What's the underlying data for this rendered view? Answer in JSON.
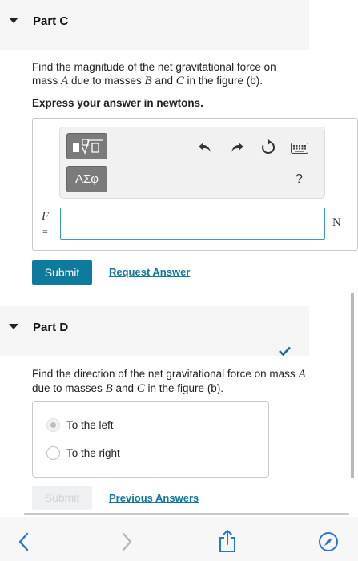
{
  "part_c": {
    "title": "Part C",
    "question_pre": "Find the magnitude of the net gravitational force on mass ",
    "mass_a": "A",
    "question_mid1": " due to masses ",
    "mass_b": "B",
    "question_mid2": " and ",
    "mass_c": "C",
    "question_post": " in the figure (b).",
    "instruction": "Express your answer in newtons.",
    "toolbar": {
      "greek_label": "ΑΣφ",
      "help_label": "?"
    },
    "input": {
      "variable": "F",
      "equals": "=",
      "value": "",
      "unit": "N"
    },
    "submit_label": "Submit",
    "request_label": "Request Answer"
  },
  "part_d": {
    "title": "Part D",
    "question_pre": "Find the direction of the net gravitational force on mass ",
    "mass_a": "A",
    "question_mid1": " due to masses ",
    "mass_b": "B",
    "question_mid2": " and ",
    "mass_c": "C",
    "question_post": " in the figure (b).",
    "options": [
      "To the left",
      "To the right"
    ],
    "submit_label": "Submit",
    "previous_label": "Previous Answers",
    "status": "correct"
  },
  "colors": {
    "accent": "#0e7a9e",
    "check": "#1a6b8c"
  }
}
